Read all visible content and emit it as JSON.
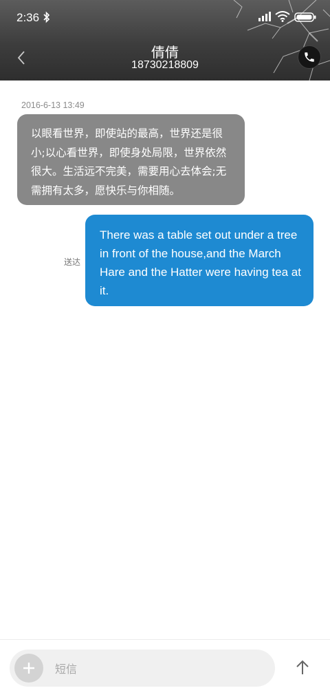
{
  "status_bar": {
    "time": "2:36",
    "icons": [
      "bluetooth-icon",
      "signal-icon",
      "wifi-icon",
      "battery-icon"
    ]
  },
  "header": {
    "back_icon": "chevron-left-icon",
    "contact_name": "倩倩",
    "contact_number": "18730218809",
    "call_icon": "phone-icon"
  },
  "conversation": {
    "timestamp": "2016-6-13 13:49",
    "incoming_message": "以眼看世界，即使站的最高，世界还是很小;以心看世界，即使身处局限，世界依然很大。生活远不完美，需要用心去体会;无需拥有太多，愿快乐与你相随。",
    "outgoing_status": "送达",
    "outgoing_message": "There was a table set out under a tree in front of the house,and the March Hare and the Hatter were having tea at it."
  },
  "composer": {
    "add_icon": "plus-icon",
    "placeholder": "短信",
    "send_icon": "arrow-up-icon"
  },
  "colors": {
    "header_bg": "#3d3d3d",
    "incoming_bubble": "#888888",
    "outgoing_bubble": "#1e8ad2",
    "composer_bg": "#f0f0f0"
  }
}
